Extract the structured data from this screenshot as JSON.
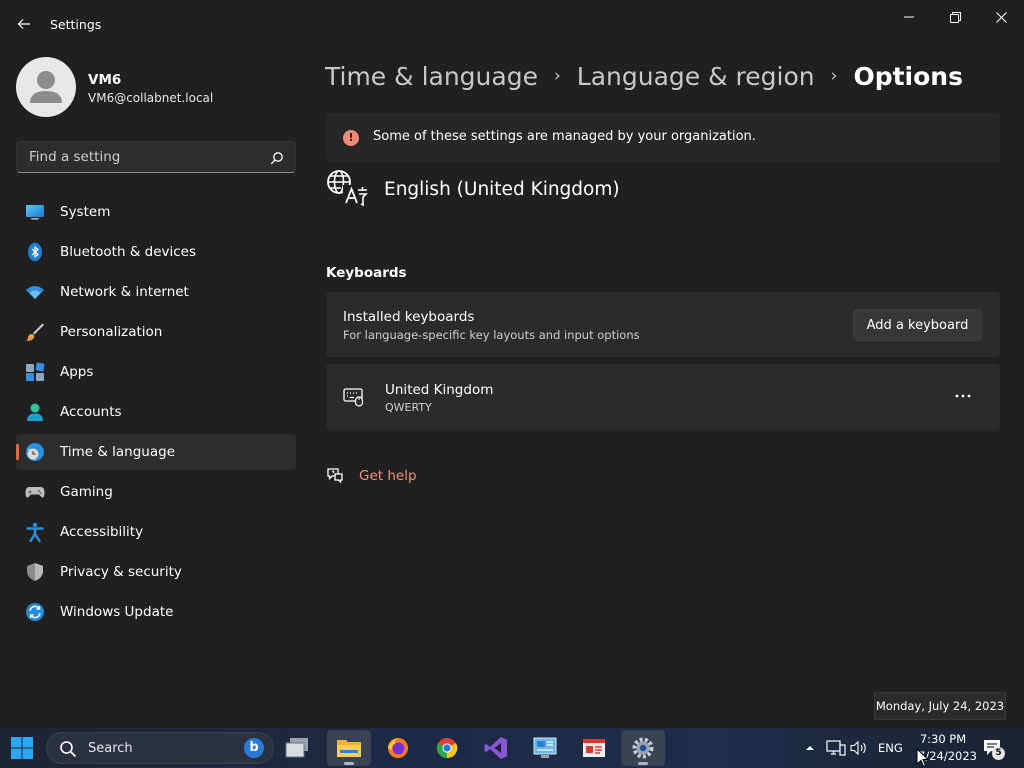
{
  "window": {
    "title": "Settings",
    "back_label": "Back"
  },
  "user": {
    "name": "VM6",
    "email": "VM6@collabnet.local"
  },
  "search": {
    "placeholder": "Find a setting"
  },
  "nav": {
    "items": [
      {
        "label": "System",
        "icon": "monitor-icon"
      },
      {
        "label": "Bluetooth & devices",
        "icon": "bluetooth-icon"
      },
      {
        "label": "Network & internet",
        "icon": "wifi-icon"
      },
      {
        "label": "Personalization",
        "icon": "brush-icon"
      },
      {
        "label": "Apps",
        "icon": "apps-icon"
      },
      {
        "label": "Accounts",
        "icon": "person-icon"
      },
      {
        "label": "Time & language",
        "icon": "globe-clock-icon",
        "selected": true
      },
      {
        "label": "Gaming",
        "icon": "gamepad-icon"
      },
      {
        "label": "Accessibility",
        "icon": "accessibility-icon"
      },
      {
        "label": "Privacy & security",
        "icon": "shield-icon"
      },
      {
        "label": "Windows Update",
        "icon": "update-icon"
      }
    ]
  },
  "breadcrumb": {
    "items": [
      "Time & language",
      "Language & region",
      "Options"
    ],
    "separator": "›"
  },
  "banner": {
    "text": "Some of these settings are managed by your organization."
  },
  "language": {
    "title": "English (United Kingdom)"
  },
  "keyboards": {
    "section_title": "Keyboards",
    "installed_title": "Installed keyboards",
    "installed_subtitle": "For language-specific key layouts and input options",
    "add_button": "Add a keyboard",
    "items": [
      {
        "name": "United Kingdom",
        "layout": "QWERTY"
      }
    ],
    "more_label": "···"
  },
  "help": {
    "label": "Get help"
  },
  "tooltip": {
    "date": "Monday, July 24, 2023"
  },
  "taskbar": {
    "search_label": "Search",
    "bing_label": "b",
    "tray": {
      "language": "ENG",
      "time": "7:30 PM",
      "date": "7/24/2023",
      "notification_count": "5"
    }
  },
  "colors": {
    "accent": "#e06a4a",
    "link": "#f09178",
    "background": "#202020",
    "card": "#2b2b2b"
  }
}
